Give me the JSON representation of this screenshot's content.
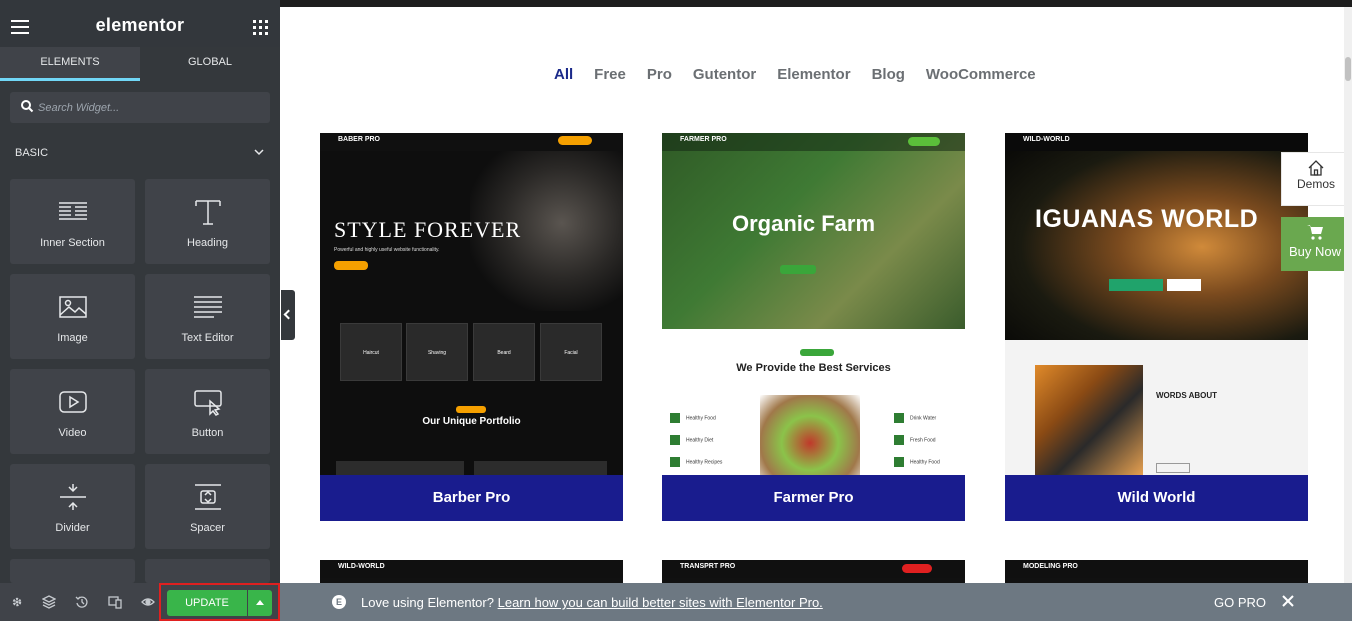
{
  "sidebar": {
    "logo": "elementor",
    "tabs": [
      "ELEMENTS",
      "GLOBAL"
    ],
    "search_placeholder": "Search Widget...",
    "section_title": "BASIC",
    "widgets": [
      {
        "label": "Inner Section",
        "icon": "inner-section-icon"
      },
      {
        "label": "Heading",
        "icon": "heading-icon"
      },
      {
        "label": "Image",
        "icon": "image-icon"
      },
      {
        "label": "Text Editor",
        "icon": "text-editor-icon"
      },
      {
        "label": "Video",
        "icon": "video-icon"
      },
      {
        "label": "Button",
        "icon": "button-icon"
      },
      {
        "label": "Divider",
        "icon": "divider-icon"
      },
      {
        "label": "Spacer",
        "icon": "spacer-icon"
      }
    ],
    "footer": {
      "update_label": "UPDATE"
    }
  },
  "filters": [
    "All",
    "Free",
    "Pro",
    "Gutentor",
    "Elementor",
    "Blog",
    "WooCommerce"
  ],
  "templates": [
    {
      "title": "Barber Pro",
      "brand": "BABER PRO",
      "hero": "STYLE FOREVER",
      "hero_sub": "Powerful and highly useful website functionality.",
      "section": "Our Unique Portfolio",
      "services": [
        "Haircut",
        "Shaving",
        "Beard",
        "Facial"
      ]
    },
    {
      "title": "Farmer Pro",
      "brand": "FARMER PRO",
      "hero": "Organic Farm",
      "section": "We Provide the Best Services",
      "features_left": [
        "Healthy Food",
        "Healthy Diet",
        "Healthy Recipes"
      ],
      "features_right": [
        "Drink Water",
        "Fresh Food",
        "Healthy Food"
      ]
    },
    {
      "title": "Wild World",
      "brand": "WILD-WORLD",
      "hero": "IGUANAS WORLD",
      "section": "WORDS ABOUT"
    }
  ],
  "second_row": [
    {
      "brand": "WILD-WORLD"
    },
    {
      "brand": "TRANSPRT PRO"
    },
    {
      "brand": "MODELING PRO"
    }
  ],
  "side_buttons": {
    "demos": "Demos",
    "buy": "Buy Now"
  },
  "promo": {
    "text": "Love using Elementor?",
    "link": "Learn how you can build better sites with Elementor Pro.",
    "gopro": "GO PRO"
  },
  "colors": {
    "accent_green": "#39b54a",
    "caption_blue": "#191c8e",
    "active_filter": "#1b2a8a"
  }
}
